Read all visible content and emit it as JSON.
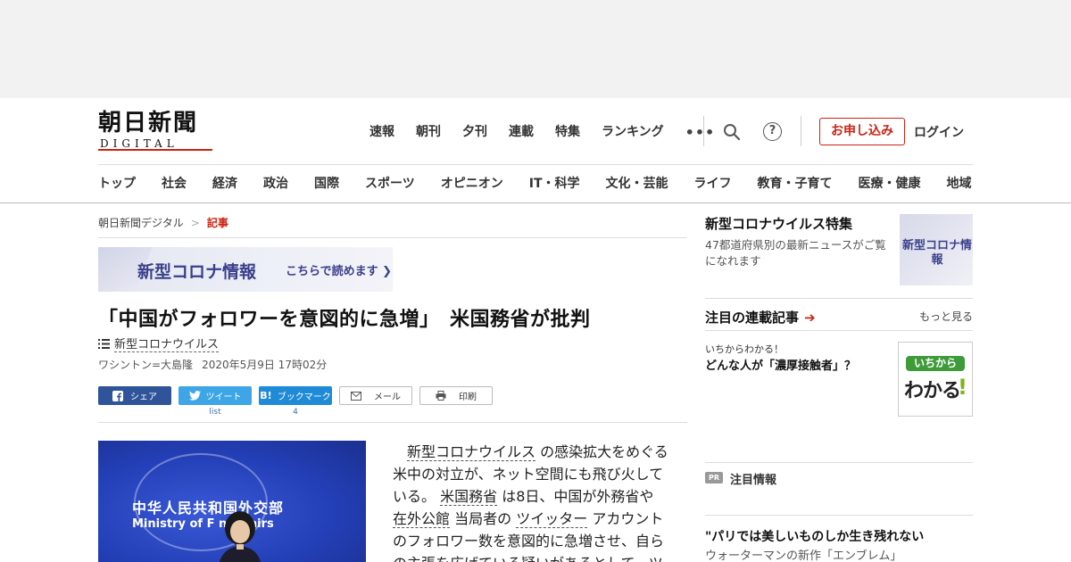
{
  "header": {
    "logo_jp": "朝日新聞",
    "logo_en": "DIGITAL",
    "top_links": [
      "速報",
      "朝刊",
      "夕刊",
      "連載",
      "特集",
      "ランキング"
    ],
    "more_label": "•••",
    "help_label": "?",
    "apply_label": "お申し込み",
    "login_label": "ログイン",
    "categories": [
      "トップ",
      "社会",
      "経済",
      "政治",
      "国際",
      "スポーツ",
      "オピニオン",
      "IT・科学",
      "文化・芸能",
      "ライフ",
      "教育・子育て",
      "医療・健康",
      "地域"
    ]
  },
  "breadcrumb": {
    "home": "朝日新聞デジタル",
    "separator": ">",
    "current": "記事"
  },
  "corona_banner": {
    "title": "新型コロナ情報",
    "link": "こちらで読めます ❯"
  },
  "article": {
    "headline": "「中国がフォロワーを意図的に急増」　米国務省が批判",
    "topic_tag": "新型コロナウイルス",
    "author": "ワシントン=大島隆",
    "date": "2020年5月9日 17時02分",
    "photo_text_cn": "中华人民共和国外交部",
    "photo_text_en": "Ministry of F   n Affairs",
    "body": {
      "kw1": "新型コロナウイルス",
      "t1": "の感染拡大をめぐる米中の対立が、ネット空間にも飛び火している。",
      "kw2": "米国務省",
      "t2": "は8日、中国が外務省や",
      "kw3": "在外公館",
      "t3": "当局者の",
      "kw4": "ツイッター",
      "t4": "アカウントのフォロワー数を意図的に急増させ、自らの主張を広げている疑いがあるとして、ツ"
    }
  },
  "share": {
    "facebook": "シェア",
    "twitter": "ツイート",
    "twitter_count": "list",
    "hatena": "ブックマーク",
    "hatena_count": "4",
    "mail": "メール",
    "print": "印刷",
    "hatena_icon": "B!"
  },
  "sidebar": {
    "feature_title": "新型コロナウイルス特集",
    "feature_desc": "47都道府県別の最新ニュースがご覧になれます",
    "feature_thumb": "新型コロナ情報",
    "series_heading": "注目の連載記事",
    "series_arrow": "➔",
    "series_more": "もっと見る",
    "series_kicker": "いちからわかる！",
    "series_title": "どんな人が「濃厚接触者」？",
    "series_thumb_top": "いちから",
    "series_thumb_main": "わかる",
    "series_thumb_mark": "!",
    "pr_badge": "PR",
    "pr_heading": "注目情報",
    "pr_item_title": "\"パリでは美しいものしか生き残れない",
    "pr_item_sub": "ウォーターマンの新作「エンブレム」"
  },
  "colors": {
    "brand_red": "#cc2211",
    "corona_purple": "#3a3f8a",
    "facebook": "#2f5499",
    "twitter": "#3ea6e6",
    "hatena": "#1f8ad6"
  }
}
